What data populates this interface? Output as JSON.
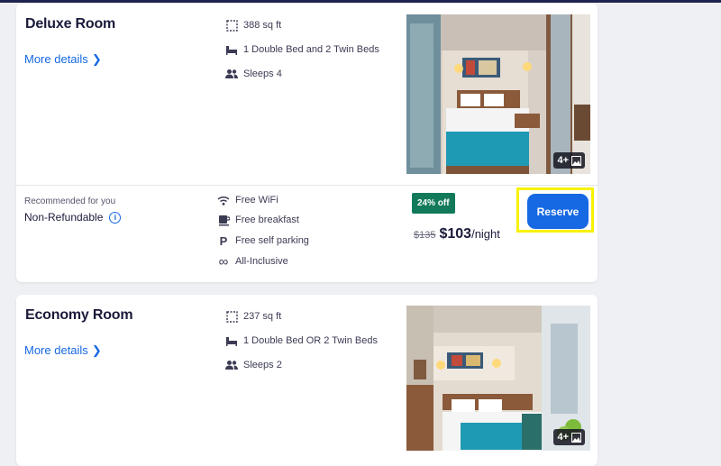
{
  "rooms": [
    {
      "name": "Deluxe Room",
      "more_details": "More details",
      "size": "388 sq ft",
      "beds": "1 Double Bed and 2 Twin Beds",
      "sleeps": "Sleeps 4",
      "photo_count": "4+",
      "recommended": "Recommended for you",
      "refund_policy": "Non-Refundable",
      "amenities": [
        "Free WiFi",
        "Free breakfast",
        "Free self parking",
        "All-Inclusive"
      ],
      "discount": "24% off",
      "old_price": "$135",
      "price": "$103",
      "per_night": "/night",
      "reserve_label": "Reserve"
    },
    {
      "name": "Economy Room",
      "more_details": "More details",
      "size": "237 sq ft",
      "beds": "1 Double Bed OR 2 Twin Beds",
      "sleeps": "Sleeps 2",
      "photo_count": "4+"
    }
  ],
  "icons": {
    "size": "floor-plan-icon",
    "beds": "bed-icon",
    "sleeps": "people-icon",
    "wifi": "wifi-icon",
    "breakfast": "coffee-cup-icon",
    "parking": "parking-icon",
    "all_inclusive": "infinity-icon",
    "info": "info-icon",
    "chevron": "chevron-right-icon",
    "gallery": "gallery-icon"
  },
  "colors": {
    "accent": "#1668e3",
    "discount": "#127a5a",
    "highlight": "#f7f200",
    "title": "#1a1a3a"
  }
}
